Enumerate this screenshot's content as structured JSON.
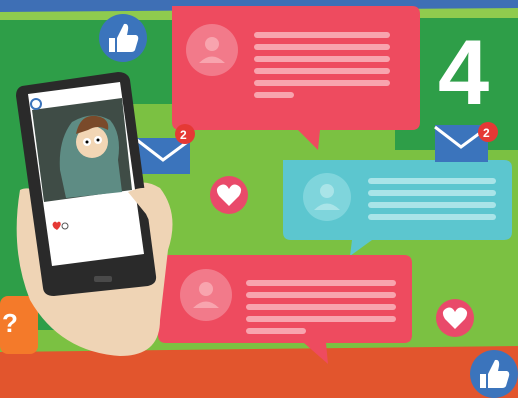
{
  "colors": {
    "blue_band": "#3E6FB5",
    "green_main": "#7BC142",
    "green_dark": "#2E9E48",
    "green_light": "#8FCB4E",
    "orange": "#F47A2A",
    "red_orange": "#E2552D",
    "bubble_red": "#EE4B5F",
    "bubble_red_line": "#F8A4AE",
    "bubble_cyan": "#5CC6CF",
    "bubble_cyan_line": "#A9E4E8",
    "like_blue": "#3B74BC",
    "heart_pink": "#E94A6A",
    "mail_blue": "#3B74BC",
    "badge_red": "#E53935",
    "phone_body": "#2A2A2A",
    "skin": "#EFD4B5"
  },
  "icons": {
    "like_top": "thumbs-up-icon",
    "like_bottom": "thumbs-up-icon",
    "mail_left": "envelope-icon",
    "mail_right": "envelope-icon",
    "heart_middle": "heart-icon",
    "heart_right": "heart-icon",
    "avatar": "user-avatar-icon"
  },
  "notifications": {
    "mail_left_count": "2",
    "mail_right_count": "2"
  },
  "big_number": "4"
}
